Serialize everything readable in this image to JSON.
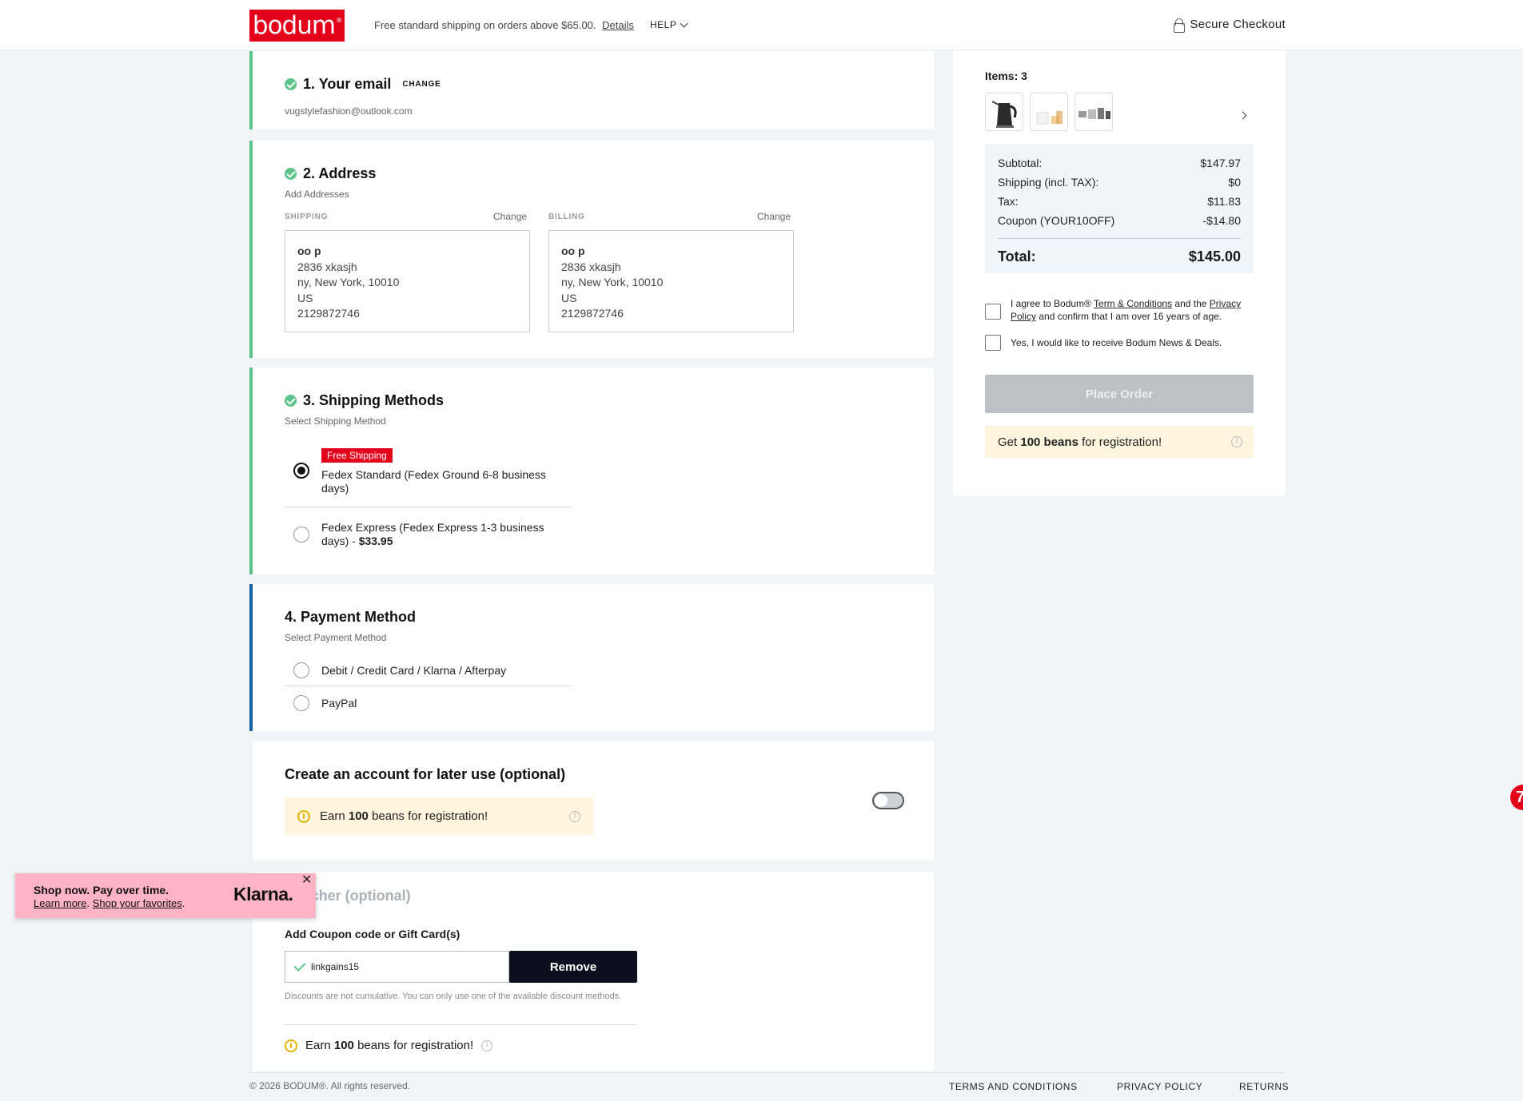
{
  "header": {
    "logo": "bodum",
    "shipping_note": "Free standard shipping on orders above $65.00.",
    "details_link": "Details",
    "help": "HELP",
    "secure_checkout": "Secure Checkout"
  },
  "email_step": {
    "title": "1. Your email",
    "change": "CHANGE",
    "email": "vugstylefashion@outlook.com"
  },
  "address_step": {
    "title": "2. Address",
    "subtitle": "Add Addresses",
    "shipping_label": "SHIPPING",
    "billing_label": "BILLING",
    "change": "Change",
    "shipping": {
      "name": "oo p",
      "line1": "2836 xkasjh",
      "line2": "ny, New York, 10010",
      "country": "US",
      "phone": "2129872746"
    },
    "billing": {
      "name": "oo p",
      "line1": "2836 xkasjh",
      "line2": "ny, New York, 10010",
      "country": "US",
      "phone": "2129872746"
    }
  },
  "shipping_step": {
    "title": "3. Shipping Methods",
    "subtitle": "Select Shipping Method",
    "free_tag": "Free Shipping",
    "options": [
      {
        "label": "Fedex Standard (Fedex Ground 6-8 business days)",
        "selected": true
      },
      {
        "label": "Fedex Express (Fedex Express 1-3 business days) - ",
        "price": "$33.95",
        "selected": false
      }
    ]
  },
  "payment_step": {
    "title": "4. Payment Method",
    "subtitle": "Select Payment Method",
    "options": [
      "Debit / Credit Card / Klarna / Afterpay",
      "PayPal"
    ]
  },
  "account": {
    "title": "Create an account for later use (optional)",
    "beans_prefix": "Earn",
    "beans_count": "100",
    "beans_suffix": "beans for registration!",
    "toggle_on": false
  },
  "voucher": {
    "title": "Voucher (optional)",
    "coupon_label": "Add Coupon code or Gift Card(s)",
    "coupon_value": "linkgains15",
    "remove": "Remove",
    "note": "Discounts are not cumulative. You can only use one of the available discount methods.",
    "beans_prefix": "Earn",
    "beans_count": "100",
    "beans_suffix": "beans for registration!"
  },
  "klarna": {
    "headline": "Shop now. Pay over time.",
    "learn_more": "Learn more",
    "shop_favorites": "Shop your favorites",
    "brand": "Klarna.",
    "close": "✕"
  },
  "summary": {
    "items_label": "Items: 3",
    "rows": [
      {
        "label": "Subtotal:",
        "value": "$147.97"
      },
      {
        "label": "Shipping (incl. TAX):",
        "value": "$0"
      },
      {
        "label": "Tax:",
        "value": "$11.83"
      },
      {
        "label": "Coupon (YOUR10OFF)",
        "value": "-$14.80"
      }
    ],
    "total_label": "Total:",
    "total_value": "$145.00",
    "agree_1": "I agree to Bodum® ",
    "terms_link": "Term & Conditions",
    "agree_2": " and the ",
    "privacy_link": "Privacy Policy",
    "agree_3": " and confirm that I am over 16 years of age.",
    "news": "Yes, I would like to receive Bodum News & Deals.",
    "place_order": "Place Order",
    "beans_prefix": "Get",
    "beans_bold": "100 beans",
    "beans_suffix": "for registration!"
  },
  "footer": {
    "copyright": "© 2026 BODUM®. All rights reserved.",
    "links": [
      "TERMS AND CONDITIONS",
      "PRIVACY POLICY",
      "RETURNS"
    ]
  },
  "colors": {
    "brand_red": "#e2001a",
    "done_green": "#5cc38a",
    "active_blue": "#1464a5",
    "beans_bg": "#fdf5dd"
  }
}
